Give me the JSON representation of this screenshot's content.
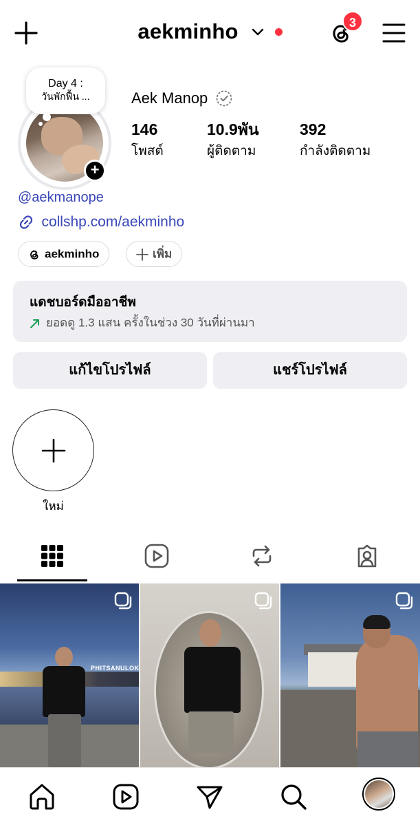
{
  "header": {
    "title": "aekminho",
    "notification_badge": "3",
    "unread_dot_color": "#ff3040"
  },
  "profile": {
    "note_line1": "Day 4 :",
    "note_line2": "วันพักฟื้น ...",
    "display_name": "Aek Manop",
    "stats": [
      {
        "value": "146",
        "label": "โพสต์"
      },
      {
        "value": "10.9พัน",
        "label": "ผู้ติดตาม"
      },
      {
        "value": "392",
        "label": "กำลังติดตาม"
      }
    ],
    "threads_handle": "@aekmanope",
    "link": "collshp.com/aekminho",
    "chips": {
      "threads": "aekminho",
      "add": "เพิ่ม"
    }
  },
  "dashboard": {
    "title": "แดชบอร์ดมืออาชีพ",
    "subtitle": "ยอดดู 1.3 แสน ครั้งในช่วง 30 วันที่ผ่านมา",
    "arrow_color": "#1f9d55"
  },
  "buttons": {
    "edit": "แก้ไขโปรไฟล์",
    "share": "แชร์โปรไฟล์"
  },
  "highlights": {
    "new_label": "ใหม่"
  },
  "tabs": [
    "grid-icon",
    "reels-icon",
    "reposts-icon",
    "tagged-icon"
  ],
  "posts": {
    "post1_sign": "PHITSANULOK"
  },
  "colors": {
    "link": "#3946b8",
    "badge": "#ff3040",
    "surface": "#efeff3"
  },
  "bottom_nav": [
    "home-icon",
    "reels-icon",
    "send-icon",
    "search-icon",
    "profile-avatar"
  ]
}
